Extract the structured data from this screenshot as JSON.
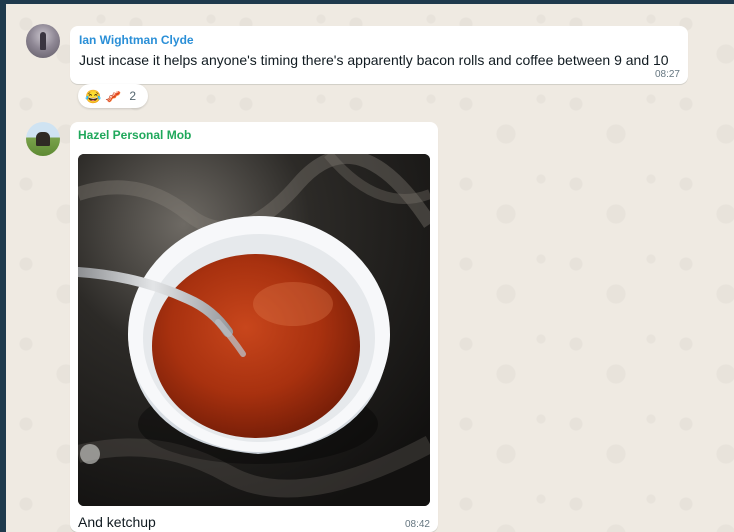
{
  "messages": [
    {
      "sender": "Ian Wightman Clyde",
      "text": "Just incase it helps anyone's timing there's apparently bacon rolls and coffee between 9 and 10",
      "time": "08:27",
      "reactions": {
        "emojis": [
          "😂",
          "🥓"
        ],
        "count": "2"
      }
    },
    {
      "sender": "Hazel Personal Mob",
      "caption": "And ketchup",
      "time": "08:42"
    }
  ],
  "colors": {
    "chat_background": "#efeae2",
    "sender_1": "#2a8fd7",
    "sender_2": "#1fa85b"
  }
}
